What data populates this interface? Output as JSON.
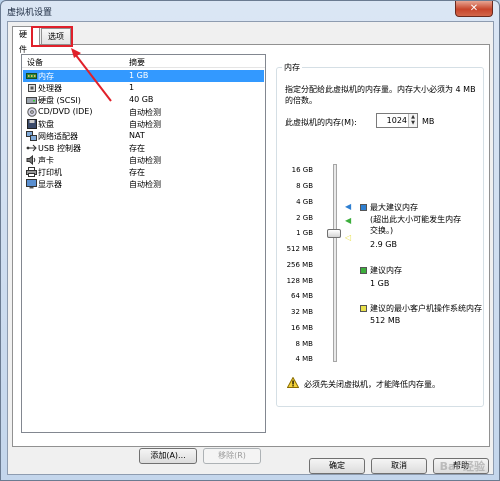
{
  "window": {
    "title": "虚拟机设置",
    "close_glyph": "✕"
  },
  "tabs": [
    {
      "label": "硬件",
      "active": true
    },
    {
      "label": "选项",
      "active": false
    }
  ],
  "device_list": {
    "columns": {
      "device": "设备",
      "summary": "摘要"
    },
    "rows": [
      {
        "icon": "memory-icon",
        "name": "内存",
        "summary": "1 GB",
        "selected": true
      },
      {
        "icon": "processor-icon",
        "name": "处理器",
        "summary": "1",
        "selected": false
      },
      {
        "icon": "hard-disk-icon",
        "name": "硬盘 (SCSI)",
        "summary": "40 GB",
        "selected": false
      },
      {
        "icon": "cd-dvd-icon",
        "name": "CD/DVD (IDE)",
        "summary": "自动检测",
        "selected": false
      },
      {
        "icon": "floppy-icon",
        "name": "软盘",
        "summary": "自动检测",
        "selected": false
      },
      {
        "icon": "network-adapter-icon",
        "name": "网络适配器",
        "summary": "NAT",
        "selected": false
      },
      {
        "icon": "usb-controller-icon",
        "name": "USB 控制器",
        "summary": "存在",
        "selected": false
      },
      {
        "icon": "sound-card-icon",
        "name": "声卡",
        "summary": "自动检测",
        "selected": false
      },
      {
        "icon": "printer-icon",
        "name": "打印机",
        "summary": "存在",
        "selected": false
      },
      {
        "icon": "display-icon",
        "name": "显示器",
        "summary": "自动检测",
        "selected": false
      }
    ],
    "add_button": "添加(A)...",
    "remove_button": "移除(R)"
  },
  "memory_panel": {
    "group_title": "内存",
    "description": "指定分配给此虚拟机的内存量。内存大小必须为 4 MB 的倍数。",
    "memory_label": "此虚拟机的内存(M):",
    "memory_value": "1024",
    "memory_unit": "MB",
    "scale_labels": [
      "16 GB",
      "8 GB",
      "4 GB",
      "2 GB",
      "1 GB",
      "512 MB",
      "256 MB",
      "128 MB",
      "64 MB",
      "32 MB",
      "16 MB",
      "8 MB",
      "4 MB"
    ],
    "max_recommended": {
      "label": "最大建议内存",
      "note": "(超出此大小可能发生内存交换。)",
      "value": "2.9 GB",
      "color": "#2e7fd1"
    },
    "recommended": {
      "label": "建议内存",
      "value": "1 GB",
      "color": "#3cae3c"
    },
    "min_recommended": {
      "label": "建议的最小客户机操作系统内存",
      "value": "512 MB",
      "color": "#e8e04a"
    },
    "warning": "必须先关闭虚拟机，才能降低内存量。"
  },
  "dialog_buttons": {
    "ok": "确定",
    "cancel": "取消",
    "help": "帮助"
  },
  "annotation": {
    "color": "#e0202a"
  },
  "watermark": "Bai 经验"
}
